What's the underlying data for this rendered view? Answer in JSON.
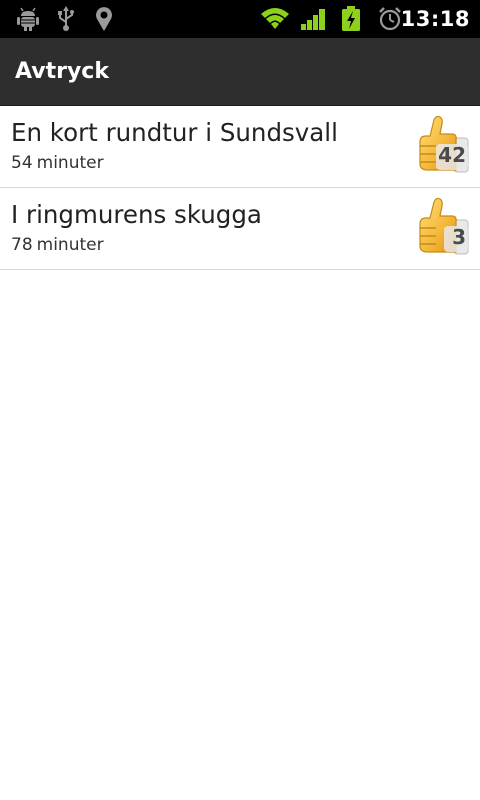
{
  "status_bar": {
    "time": "13:18",
    "left_icons": [
      "debug-icon",
      "usb-icon",
      "location-icon"
    ],
    "right_icons": [
      "wifi-icon",
      "signal-icon",
      "battery-charging-icon",
      "alarm-icon"
    ],
    "accent_color": "#8ed11a"
  },
  "header": {
    "title": "Avtryck"
  },
  "list": {
    "items": [
      {
        "title": "En kort rundtur i Sundsvall",
        "duration": "54",
        "unit": "minuter",
        "likes": "42",
        "icon": "thumbs-up-icon"
      },
      {
        "title": "I ringmurens skugga",
        "duration": "78",
        "unit": "minuter",
        "likes": "3",
        "icon": "thumbs-up-icon"
      }
    ]
  }
}
